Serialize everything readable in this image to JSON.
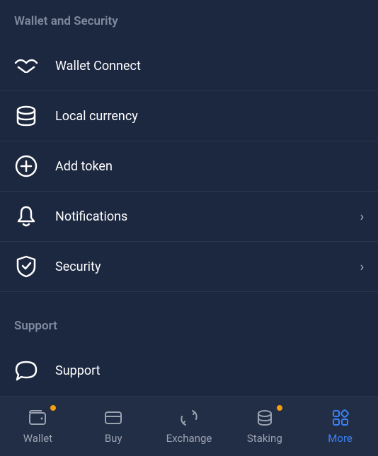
{
  "sections": {
    "wallet_security": {
      "header": "Wallet and Security",
      "items": [
        {
          "label": "Wallet Connect",
          "icon": "wallet-connect",
          "chevron": false
        },
        {
          "label": "Local currency",
          "icon": "currency",
          "chevron": false
        },
        {
          "label": "Add token",
          "icon": "plus-circle",
          "chevron": false
        },
        {
          "label": "Notifications",
          "icon": "bell",
          "chevron": true
        },
        {
          "label": "Security",
          "icon": "shield",
          "chevron": true
        }
      ]
    },
    "support": {
      "header": "Support",
      "items": [
        {
          "label": "Support",
          "icon": "chat",
          "chevron": false
        }
      ]
    }
  },
  "nav": {
    "items": [
      {
        "label": "Wallet",
        "icon": "wallet",
        "active": false,
        "badge": true
      },
      {
        "label": "Buy",
        "icon": "card",
        "active": false,
        "badge": false
      },
      {
        "label": "Exchange",
        "icon": "exchange",
        "active": false,
        "badge": false
      },
      {
        "label": "Staking",
        "icon": "staking",
        "active": false,
        "badge": true
      },
      {
        "label": "More",
        "icon": "more",
        "active": true,
        "badge": false
      }
    ]
  }
}
